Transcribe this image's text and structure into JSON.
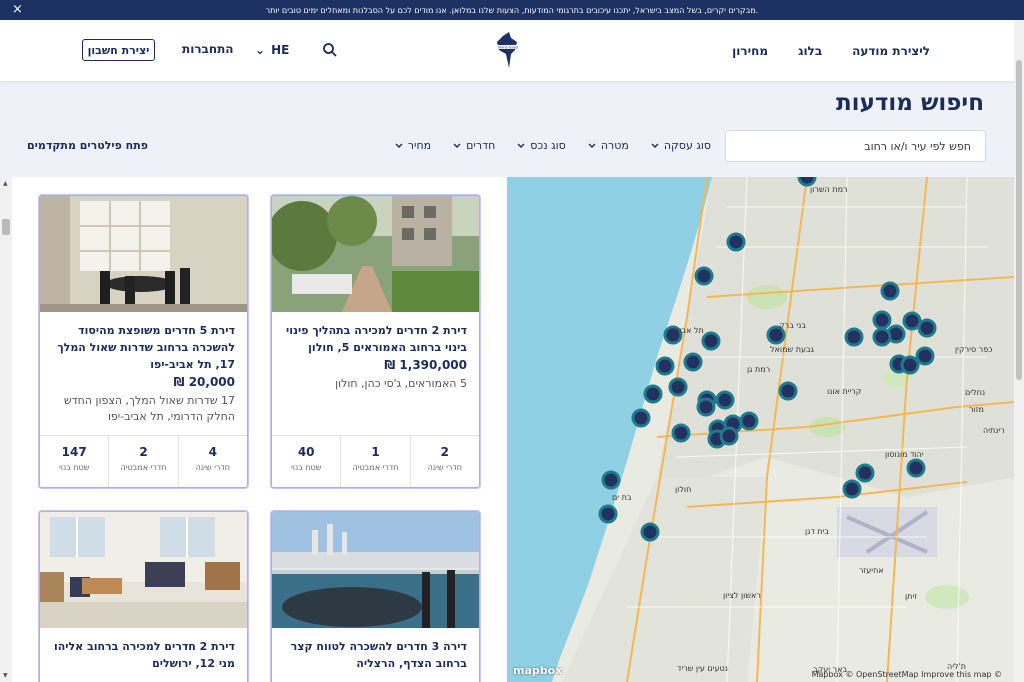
{
  "announcement": {
    "text": "מבקרים יקרים, בשל המצב בישראל, יתכנו עיכובים בתרגומי המודעות, הצעות שלנו במלואן. אנו מודים לכם על הסבלנות ומאחלים ימים טובים יותר.",
    "close_icon": "×"
  },
  "header": {
    "nav": [
      "ליצירת מודעה",
      "בלוג",
      "מחירון"
    ],
    "logo_text": "Immo Israel",
    "lang": "HE",
    "login": "התחברות",
    "signup": "יצירת חשבון"
  },
  "page": {
    "title": "חיפוש מודעות",
    "search_placeholder": "חפש לפי עיר ו/או רחוב",
    "filters": [
      "סוג עסקה",
      "מטרה",
      "סוג נכס",
      "חדרים",
      "מחיר"
    ],
    "advanced": "פתח פילטרים מתקדמים"
  },
  "listings": [
    {
      "title": "דירת 2 חדרים למכירה בתהליך פינוי בינוי ברחוב האמוראים 5, חולון",
      "price": "1,390,000 ₪",
      "address": "5 האמוראים, ג'סי כהן, חולון",
      "stats": [
        {
          "n": "2",
          "l": "חדרי שינה"
        },
        {
          "n": "1",
          "l": "חדרי אמבטיה"
        },
        {
          "n": "40",
          "l": "שטח בנוי"
        }
      ]
    },
    {
      "title": "דירת 5 חדרים משופצת מהיסוד להשכרה ברחוב שדרות שאול המלך 17, תל אביב-יפו",
      "price": "20,000 ₪",
      "address": "17 שדרות שאול המלך, הצפון החדש החלק הדרומי, תל אביב-יפו",
      "stats": [
        {
          "n": "4",
          "l": "חדרי שינה"
        },
        {
          "n": "2",
          "l": "חדרי אמבטיה"
        },
        {
          "n": "147",
          "l": "שטח בנוי"
        }
      ]
    },
    {
      "title": "דירה 3 חדרים להשכרה לטווח קצר ברחוב הצדף, הרצליה",
      "price": "",
      "address": "",
      "stats": []
    },
    {
      "title": "דירת 2 חדרים למכירה ברחוב אליהו מני 12, ירושלים",
      "price": "",
      "address": "",
      "stats": []
    }
  ],
  "map": {
    "labels": [
      "רמת השרון",
      "בני ברק",
      "תל אביב",
      "גבעת שמואל",
      "רמת גן",
      "כפר סירקין",
      "קריית אונו",
      "נחלים",
      "מזור",
      "רינתיה",
      "יהוד מונוסון",
      "חולון",
      "בת ים",
      "בית דגן",
      "ראשון לציון",
      "נטעים עין שריד",
      "באר יעקב",
      "זיתן",
      "אחיעזר",
      "ת'ליה"
    ],
    "attribution": "Mapbox © OpenStreetMap  Improve this map ©",
    "brand": "mapbox"
  }
}
